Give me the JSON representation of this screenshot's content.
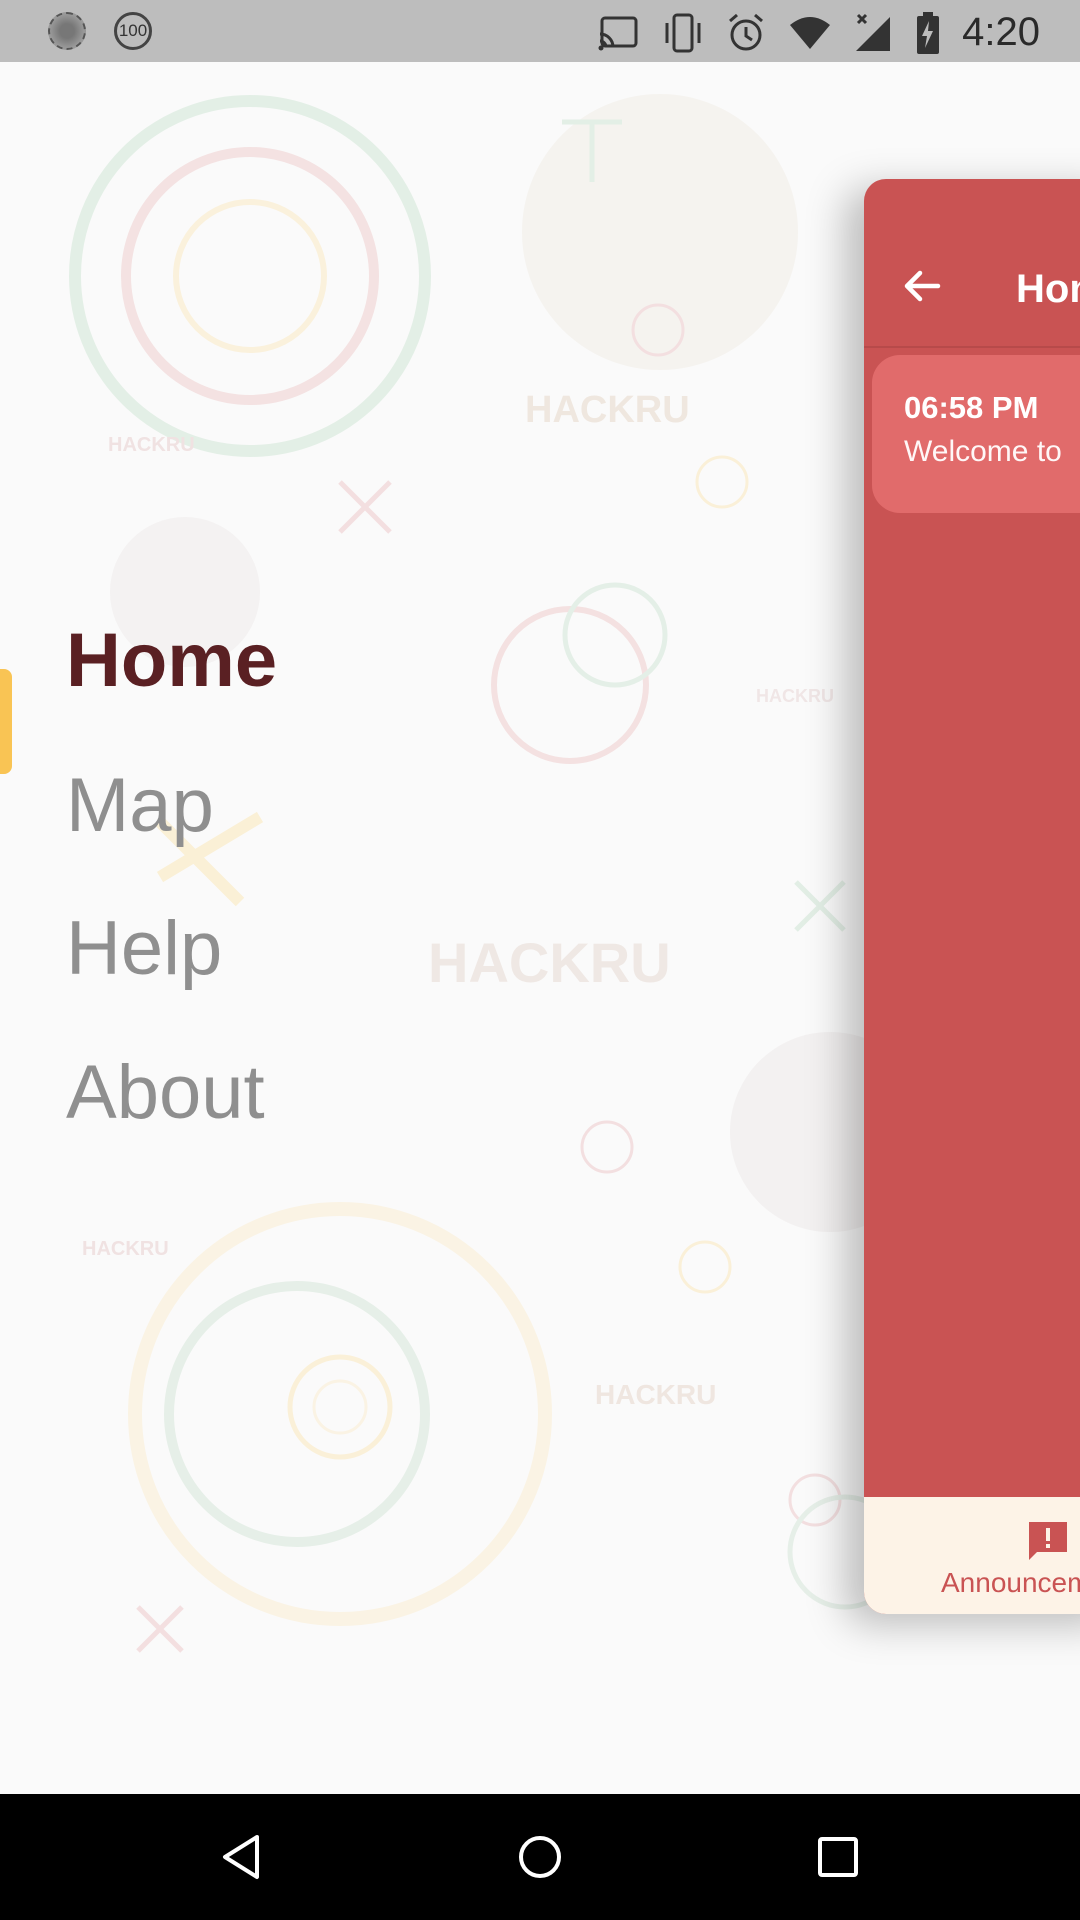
{
  "status_bar": {
    "left_badge": "100",
    "time": "4:20",
    "icons": [
      "cast-icon",
      "vibrate-icon",
      "alarm-icon",
      "wifi-icon",
      "signal-icon",
      "battery-charging-icon"
    ]
  },
  "background": {
    "logo_text": "HACKRU"
  },
  "drawer": {
    "items": [
      {
        "label": "Home",
        "active": true
      },
      {
        "label": "Map",
        "active": false
      },
      {
        "label": "Help",
        "active": false
      },
      {
        "label": "About",
        "active": false
      }
    ]
  },
  "home_panel": {
    "title": "Hom",
    "announcement": {
      "time": "06:58 PM",
      "text": "Welcome to"
    },
    "bottom_tab": {
      "label": "Announcem",
      "icon": "announcement-icon"
    }
  },
  "system_nav": {
    "buttons": [
      "back-icon",
      "home-icon",
      "recents-icon"
    ]
  },
  "colors": {
    "accent_red": "#c95353",
    "active_indicator": "#f9c454",
    "active_text": "#5a2023",
    "inactive_text": "#8f8f8f"
  }
}
